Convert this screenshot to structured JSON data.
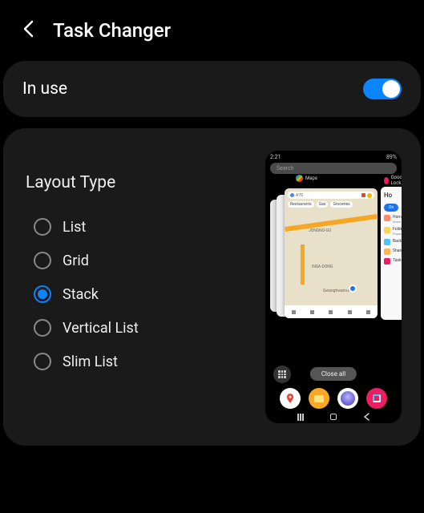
{
  "header": {
    "title": "Task Changer"
  },
  "in_use": {
    "label": "In use",
    "enabled": true
  },
  "layout": {
    "section_title": "Layout Type",
    "options": [
      {
        "label": "List",
        "selected": false
      },
      {
        "label": "Grid",
        "selected": false
      },
      {
        "label": "Stack",
        "selected": true
      },
      {
        "label": "Vertical List",
        "selected": false
      },
      {
        "label": "Slim List",
        "selected": false
      }
    ]
  },
  "preview": {
    "status": {
      "time": "2:21",
      "right": "89%"
    },
    "search_placeholder": "Search",
    "app_labels": {
      "maps": "Maps",
      "goodlock": "Good Lock"
    },
    "map_search": "A70",
    "map_chips": [
      "Restaurants",
      "Gas",
      "Groceries"
    ],
    "map_areas": [
      "JONGNO-GU",
      "INSA-DONG",
      "Gwanghwamun"
    ],
    "goodlock_panel": {
      "title": "Ho",
      "btn": "On",
      "rows": [
        {
          "title": "Home screen",
          "sub": "Share recently"
        },
        {
          "title": "Folder",
          "sub": "Popup"
        },
        {
          "title": "Back up an",
          "sub": ""
        },
        {
          "title": "Share Home",
          "sub": ""
        },
        {
          "title": "Task Chan",
          "sub": ""
        }
      ]
    },
    "close_all": "Close all"
  }
}
